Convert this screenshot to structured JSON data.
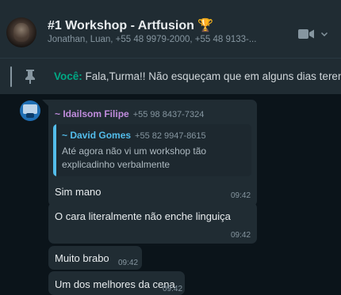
{
  "header": {
    "title": "#1 Workshop - Artfusion 🏆",
    "participants": "Jonathan, Luan, +55 48 9979-2000, +55 48 9133-..."
  },
  "pinned": {
    "sender": "Você:",
    "text": "Fala,Turma!! Não esqueçam que em alguns dias teremos"
  },
  "messages": [
    {
      "sender_name": "~ Idailsom Filipe",
      "sender_phone": "+55 98 8437-7324",
      "quote_name": "~ David Gomes",
      "quote_phone": "+55 82 9947-8615",
      "quote_text": "Até agora não vi um workshop tão explicadinho verbalmente",
      "text": "Sim mano",
      "time": "09:42"
    },
    {
      "text": "O cara literalmente não enche linguiça",
      "time": "09:42"
    },
    {
      "text": "Muito brabo",
      "time": "09:42"
    },
    {
      "text": "Um dos melhores da cena",
      "time": "09:42"
    }
  ],
  "colors": {
    "header_bg": "#202c33",
    "chat_bg": "#0b141a",
    "bubble_bg": "#202c33",
    "accent_green": "#00a884",
    "quote_accent": "#53bdeb",
    "sender_color": "#c08cdd"
  },
  "icons": {
    "video": "video-camera-icon",
    "chevron": "chevron-down-icon",
    "pin": "pin-icon"
  }
}
